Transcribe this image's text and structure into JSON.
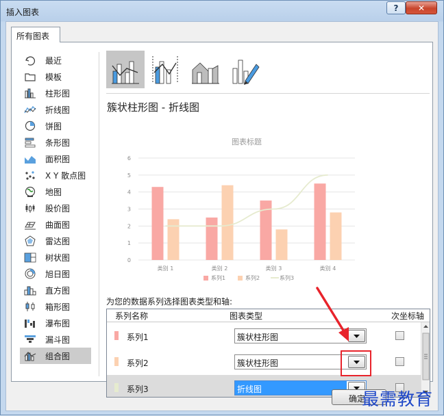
{
  "window": {
    "title": "插入图表",
    "help": "?",
    "close": "✕"
  },
  "tab": "所有图表",
  "categories": [
    {
      "label": "最近",
      "icon": "undo-icon"
    },
    {
      "label": "模板",
      "icon": "folder-icon"
    },
    {
      "label": "柱形图",
      "icon": "column-chart-icon"
    },
    {
      "label": "折线图",
      "icon": "line-chart-icon"
    },
    {
      "label": "饼图",
      "icon": "pie-chart-icon"
    },
    {
      "label": "条形图",
      "icon": "bar-chart-icon"
    },
    {
      "label": "面积图",
      "icon": "area-chart-icon"
    },
    {
      "label": "X Y 散点图",
      "icon": "scatter-chart-icon"
    },
    {
      "label": "地图",
      "icon": "map-chart-icon"
    },
    {
      "label": "股价图",
      "icon": "stock-chart-icon"
    },
    {
      "label": "曲面图",
      "icon": "surface-chart-icon"
    },
    {
      "label": "雷达图",
      "icon": "radar-chart-icon"
    },
    {
      "label": "树状图",
      "icon": "treemap-chart-icon"
    },
    {
      "label": "旭日图",
      "icon": "sunburst-chart-icon"
    },
    {
      "label": "直方图",
      "icon": "histogram-chart-icon"
    },
    {
      "label": "箱形图",
      "icon": "box-whisker-chart-icon"
    },
    {
      "label": "瀑布图",
      "icon": "waterfall-chart-icon"
    },
    {
      "label": "漏斗图",
      "icon": "funnel-chart-icon"
    },
    {
      "label": "组合图",
      "icon": "combo-chart-icon",
      "selected": true
    }
  ],
  "subtypes": [
    {
      "icon": "clustered-column-line-icon",
      "selected": true
    },
    {
      "icon": "clustered-column-line-secondary-axis-icon"
    },
    {
      "icon": "stacked-area-clustered-column-icon"
    },
    {
      "icon": "custom-combination-icon"
    }
  ],
  "chart_type_name": "簇状柱形图 - 折线图",
  "chart_data": {
    "type": "bar",
    "title": "图表标题",
    "categories": [
      "类别 1",
      "类别 2",
      "类别 3",
      "类别 4"
    ],
    "series": [
      {
        "name": "系列1",
        "values": [
          4.3,
          2.5,
          3.5,
          4.5
        ],
        "kind": "bar",
        "color": "#f9a8a4"
      },
      {
        "name": "系列2",
        "values": [
          2.4,
          4.4,
          1.8,
          2.8
        ],
        "kind": "bar",
        "color": "#fcd1b1"
      },
      {
        "name": "系列3",
        "values": [
          2,
          2,
          3,
          5
        ],
        "kind": "line",
        "color": "#e6ebcf"
      }
    ],
    "ylim": [
      0,
      6
    ],
    "yticks": [
      "0",
      "1",
      "2",
      "3",
      "4",
      "5",
      "6"
    ],
    "grid": true,
    "legend": "bottom"
  },
  "prompt": "为您的数据系列选择图表类型和轴:",
  "table": {
    "headers": {
      "name": "系列名称",
      "type": "图表类型",
      "secondary": "次坐标轴"
    },
    "rows": [
      {
        "name": "系列1",
        "type": "簇状柱形图",
        "color": "#f9a8a4",
        "secondary": false
      },
      {
        "name": "系列2",
        "type": "簇状柱形图",
        "color": "#fcd1b1",
        "secondary": false
      },
      {
        "name": "系列3",
        "type": "折线图",
        "color": "#e6ebcf",
        "secondary": false,
        "selected": true
      }
    ]
  },
  "ok_label": "确定",
  "watermark": "最需教育",
  "colors": {
    "accent_red": "#e8232b",
    "selection_blue": "#3399ff",
    "watermark_blue": "#1e47c8"
  }
}
